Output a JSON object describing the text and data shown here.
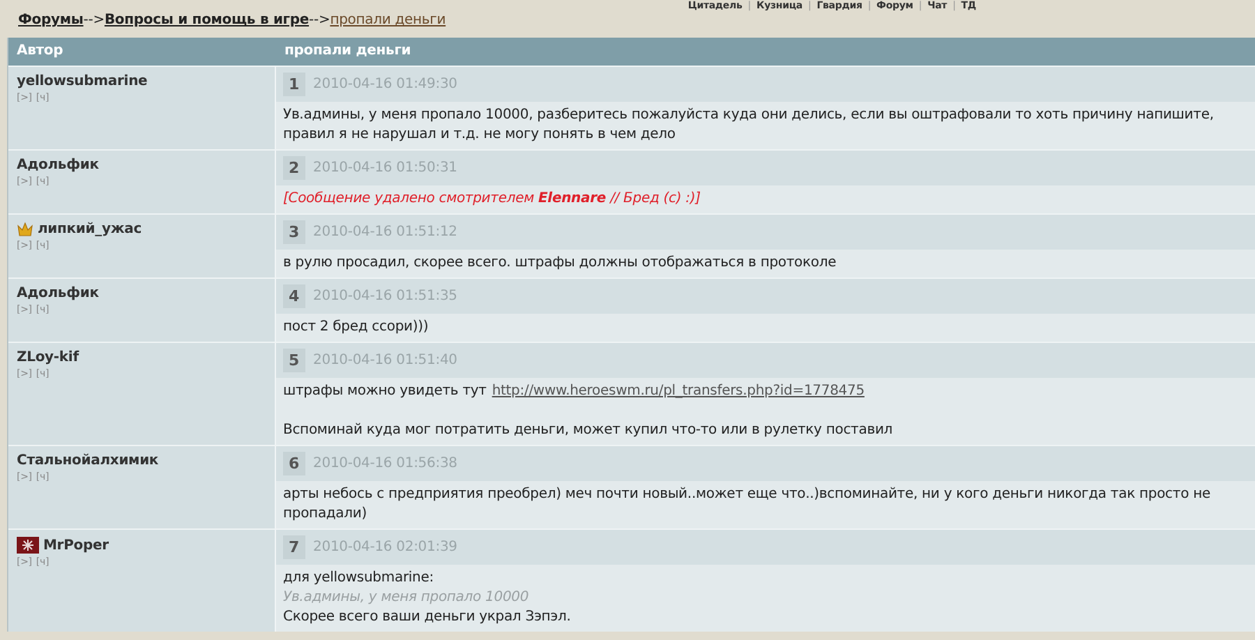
{
  "top_nav": [
    {
      "kind": "link",
      "text": "Цитадель"
    },
    {
      "kind": "sep",
      "text": "|"
    },
    {
      "kind": "link",
      "text": "Кузница"
    },
    {
      "kind": "sep",
      "text": "|"
    },
    {
      "kind": "link",
      "text": "Гвардия"
    },
    {
      "kind": "sep",
      "text": "|"
    },
    {
      "kind": "link",
      "text": "Форум"
    },
    {
      "kind": "sep",
      "text": "|"
    },
    {
      "kind": "link",
      "text": "Чат"
    },
    {
      "kind": "sep",
      "text": "|"
    },
    {
      "kind": "link",
      "text": "ТД"
    }
  ],
  "breadcrumb": [
    {
      "text": "Форумы",
      "kind": "section"
    },
    {
      "text": "-->",
      "kind": "sep"
    },
    {
      "text": "Вопросы и помощь в игре",
      "kind": "section"
    },
    {
      "text": "-->",
      "kind": "sep"
    },
    {
      "text": "пропали деньги",
      "kind": "current"
    }
  ],
  "table": {
    "columns": [
      "Автор",
      "пропали деньги"
    ],
    "posts": [
      {
        "author": "yellowsubmarine",
        "kind": "plain",
        "links": [
          "[>]",
          "[ч]"
        ],
        "number": "1",
        "time": "2010-04-16 01:49:30",
        "lines": [
          {
            "kind": "text",
            "text": "Ув.админы, у меня пропало 10000, разберитесь пожалуйста куда они делись, если вы оштрафовали то хоть причину напишите,"
          },
          {
            "kind": "text",
            "text": "правил я не нарушал и т.д. не могу понять в чем дело"
          }
        ]
      },
      {
        "author": "Адольфик",
        "kind": "plain",
        "links": [
          "[>]",
          "[ч]"
        ],
        "number": "2",
        "time": "2010-04-16 01:50:31",
        "lines": [
          {
            "kind": "deleted",
            "text": "[Сообщение удалено смотрителем **Elennare** // Бред (с) :)]"
          }
        ]
      },
      {
        "author": "липкий_ужас",
        "kind": "crown",
        "links": [
          "[>]",
          "[ч]"
        ],
        "number": "3",
        "time": "2010-04-16 01:51:12",
        "lines": [
          {
            "kind": "text",
            "text": "в рулю просадил, скорее всего. штрафы должны отображаться в протоколе"
          }
        ]
      },
      {
        "author": "Адольфик",
        "kind": "plain",
        "links": [
          "[>]",
          "[ч]"
        ],
        "number": "4",
        "time": "2010-04-16 01:51:35",
        "lines": [
          {
            "kind": "text",
            "text": "пост 2 бред ссори)))"
          }
        ]
      },
      {
        "author": "ZLoy-kif",
        "kind": "plain",
        "links": [
          "[>]",
          "[ч]"
        ],
        "number": "5",
        "time": "2010-04-16 01:51:40",
        "lines": [
          {
            "kind": "link",
            "text": "штрафы можно увидеть тут",
            "link": "http://www.heroeswm.ru/pl_transfers.php?id=1778475"
          },
          {
            "kind": "gap"
          },
          {
            "kind": "text",
            "text": "Вспоминай куда мог потратить деньги, может купил что-то или в рулетку поставил"
          }
        ]
      },
      {
        "author": "Стальнойалхимик",
        "kind": "plain",
        "links": [
          "[>]",
          "[ч]"
        ],
        "number": "6",
        "time": "2010-04-16 01:56:38",
        "lines": [
          {
            "kind": "text",
            "text": "арты небось с предприятия преобрел) меч почти новый..может еще что..)вспоминайте, ни у кого деньги никогда так просто не"
          },
          {
            "kind": "text",
            "text": "пропадали)"
          }
        ]
      },
      {
        "author": "MrPoper",
        "kind": "emblem",
        "links": [
          "[>]",
          "[ч]"
        ],
        "number": "7",
        "time": "2010-04-16 02:01:39",
        "lines": [
          {
            "kind": "text",
            "text": "для yellowsubmarine:"
          },
          {
            "kind": "quote",
            "text": "Ув.админы, у меня пропало 10000"
          },
          {
            "kind": "text",
            "text": "Скорее всего ваши деньги украл Зэпэл."
          }
        ]
      }
    ]
  }
}
